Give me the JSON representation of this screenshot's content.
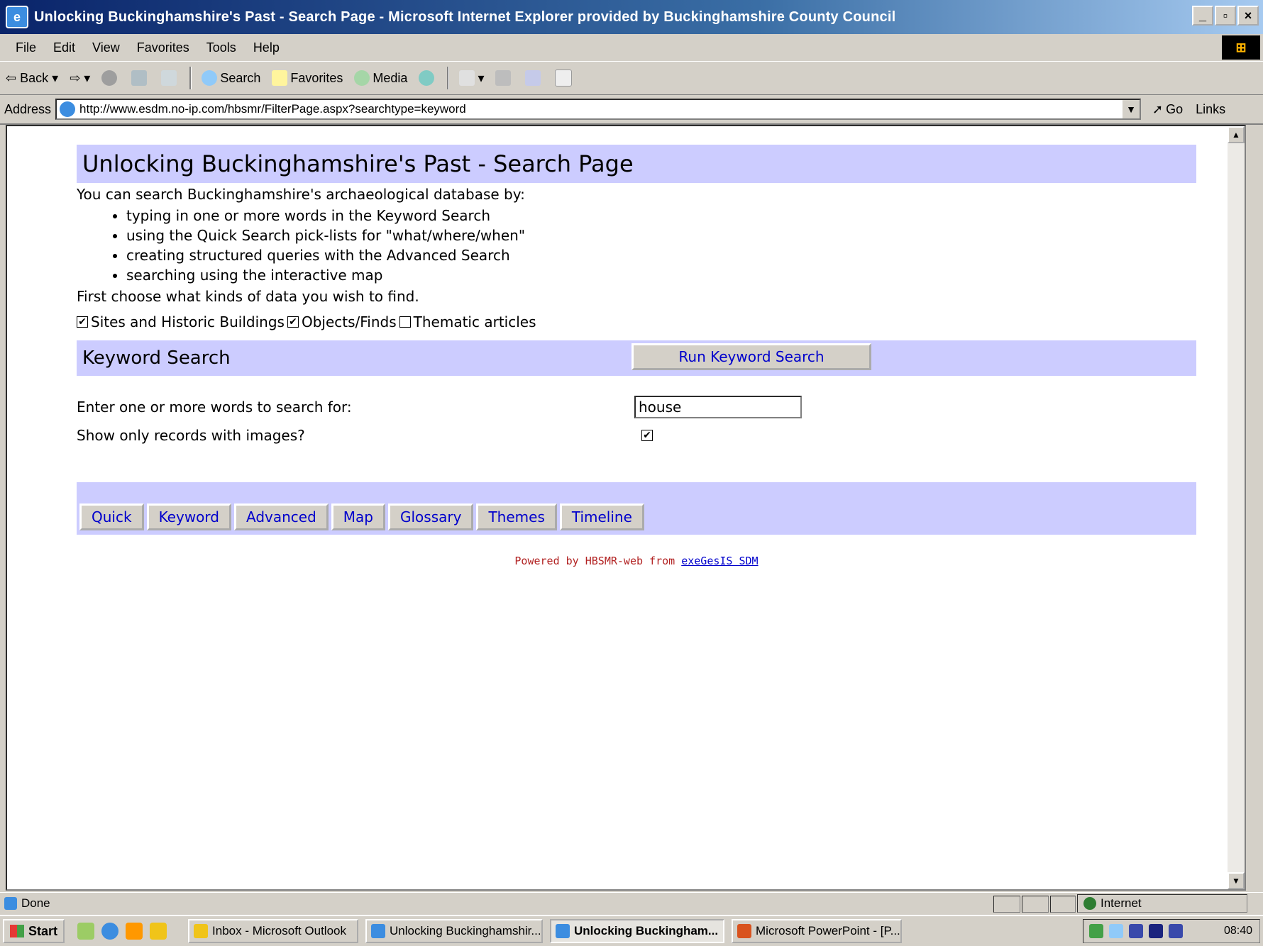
{
  "window": {
    "title": "Unlocking Buckinghamshire's Past - Search Page - Microsoft Internet Explorer provided by Buckinghamshire County Council",
    "minimize": "_",
    "maximize": "▫",
    "close": "×"
  },
  "menu": [
    "File",
    "Edit",
    "View",
    "Favorites",
    "Tools",
    "Help"
  ],
  "toolbar": {
    "back": "Back",
    "search": "Search",
    "favorites": "Favorites",
    "media": "Media"
  },
  "address": {
    "label": "Address",
    "url": "http://www.esdm.no-ip.com/hbsmr/FilterPage.aspx?searchtype=keyword",
    "go": "Go",
    "links": "Links"
  },
  "page": {
    "title": "Unlocking Buckinghamshire's Past - Search Page",
    "intro": "You can search Buckinghamshire's archaeological database by:",
    "bullets": [
      "typing in one or more words in the Keyword Search",
      "using the Quick Search pick-lists for \"what/where/when\"",
      "creating structured queries with the Advanced Search",
      "searching using the interactive map"
    ],
    "choose": "First choose what kinds of data you wish to find.",
    "filters": [
      {
        "label": "Sites and Historic Buildings",
        "checked": true
      },
      {
        "label": "Objects/Finds",
        "checked": true
      },
      {
        "label": "Thematic articles",
        "checked": false
      }
    ],
    "keyword_heading": "Keyword Search",
    "run_button": "Run Keyword Search",
    "enter_words_label": "Enter one or more words to search for:",
    "keyword_value": "house",
    "images_only_label": "Show only records with images?",
    "images_only_checked": true,
    "nav": [
      "Quick",
      "Keyword",
      "Advanced",
      "Map",
      "Glossary",
      "Themes",
      "Timeline"
    ],
    "powered_prefix": "Powered by HBSMR-web from",
    "powered_link": "exeGesIS SDM"
  },
  "status": {
    "text": "Done",
    "zone": "Internet"
  },
  "taskbar": {
    "start": "Start",
    "tasks": [
      {
        "label": "Inbox - Microsoft Outlook",
        "active": false,
        "color": "#f0c419"
      },
      {
        "label": "Unlocking Buckinghamshir...",
        "active": false,
        "color": "#3c8de0"
      },
      {
        "label": "Unlocking Buckingham...",
        "active": true,
        "color": "#3c8de0"
      },
      {
        "label": "Microsoft PowerPoint - [P...",
        "active": false,
        "color": "#d9531e"
      }
    ],
    "clock": "08:40"
  }
}
